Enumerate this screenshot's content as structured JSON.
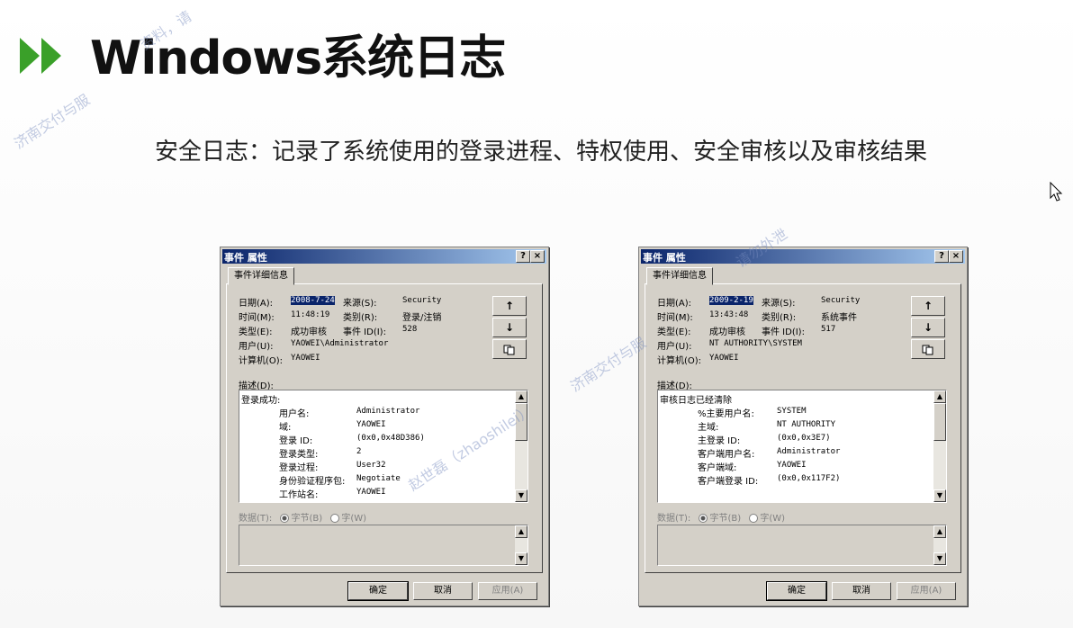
{
  "title": "Windows系统日志",
  "subtitle": "安全日志：记录了系统使用的登录进程、特权使用、安全审核以及审核结果",
  "watermark": {
    "line1": "济南交付与服",
    "line2": "资料，请",
    "line3": "济南交付与服",
    "line4": "赵世磊（zhaoshilei）",
    "line5": "请勿外泄"
  },
  "colors": {
    "arrow_green": "#3aa029",
    "title_blue": "#0a246a"
  },
  "dialogs": [
    {
      "title": "事件 属性",
      "help_btn": "?",
      "close_btn": "×",
      "tab": "事件详细信息",
      "labels": {
        "date": "日期(A):",
        "source": "来源(S):",
        "time": "时间(M):",
        "category": "类别(R):",
        "type": "类型(E):",
        "event_id": "事件 ID(I):",
        "user": "用户(U):",
        "computer": "计算机(O):",
        "desc": "描述(D):",
        "data": "数据(T):",
        "bytes": "字节(B)",
        "words": "字(W)"
      },
      "values": {
        "date": "2008-7-24",
        "source": "Security",
        "time": "11:48:19",
        "category": "登录/注销",
        "type": "成功审核",
        "event_id": "528",
        "user": "YAOWEI\\Administrator",
        "computer": "YAOWEI"
      },
      "desc_lines": [
        {
          "k": "登录成功:",
          "v": ""
        },
        {
          "k": "用户名:",
          "v": "Administrator"
        },
        {
          "k": "域:",
          "v": "YAOWEI"
        },
        {
          "k": "登录 ID:",
          "v": "(0x0,0x48D386)"
        },
        {
          "k": "登录类型:",
          "v": "2"
        },
        {
          "k": "登录过程:",
          "v": "User32"
        },
        {
          "k": "身份验证程序包:",
          "v": "Negotiate"
        },
        {
          "k": "工作站名:",
          "v": "YAOWEI"
        }
      ],
      "buttons": {
        "ok": "确定",
        "cancel": "取消",
        "apply": "应用(A)"
      },
      "side_buttons": [
        "up-arrow-icon",
        "down-arrow-icon",
        "copy-icon"
      ]
    },
    {
      "title": "事件 属性",
      "help_btn": "?",
      "close_btn": "×",
      "tab": "事件详细信息",
      "labels": {
        "date": "日期(A):",
        "source": "来源(S):",
        "time": "时间(M):",
        "category": "类别(R):",
        "type": "类型(E):",
        "event_id": "事件 ID(I):",
        "user": "用户(U):",
        "computer": "计算机(O):",
        "desc": "描述(D):",
        "data": "数据(T):",
        "bytes": "字节(B)",
        "words": "字(W)"
      },
      "values": {
        "date": "2009-2-19",
        "source": "Security",
        "time": "13:43:48",
        "category": "系统事件",
        "type": "成功审核",
        "event_id": "517",
        "user": "NT AUTHORITY\\SYSTEM",
        "computer": "YAOWEI"
      },
      "desc_lines": [
        {
          "k": "审核日志已经清除",
          "v": ""
        },
        {
          "k": "%主要用户名:",
          "v": "SYSTEM"
        },
        {
          "k": "主域:",
          "v": "NT AUTHORITY"
        },
        {
          "k": "主登录 ID:",
          "v": "(0x0,0x3E7)"
        },
        {
          "k": "客户端用户名:",
          "v": "Administrator"
        },
        {
          "k": "客户端域:",
          "v": "YAOWEI"
        },
        {
          "k": "客户端登录 ID:",
          "v": "(0x0,0x117F2)"
        }
      ],
      "buttons": {
        "ok": "确定",
        "cancel": "取消",
        "apply": "应用(A)"
      },
      "side_buttons": [
        "up-arrow-icon",
        "down-arrow-icon",
        "copy-icon"
      ]
    }
  ]
}
